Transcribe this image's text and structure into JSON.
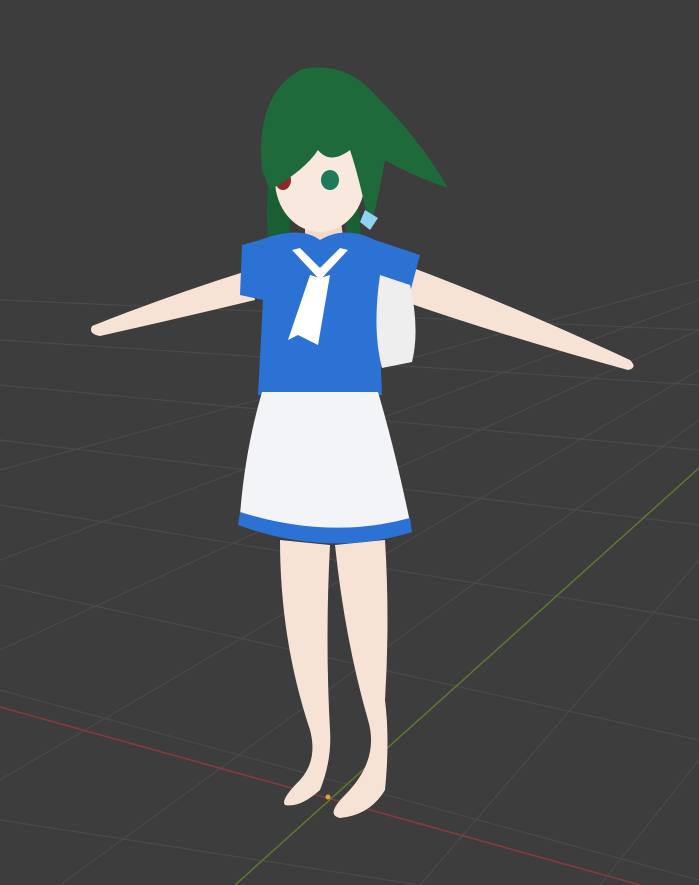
{
  "viewport": {
    "background_color": "#3d3d3d",
    "grid_color": "#4a4a4a",
    "x_axis_color": "#8a3a3f",
    "y_axis_color": "#5c7a2e"
  },
  "model": {
    "hair_color": "#1e6a3a",
    "shirt_color": "#2b72d4",
    "skirt_color": "#f2f4f8",
    "skin_color": "#f6e3d6",
    "strap_color": "#d8322e",
    "bag_color": "#f0f0f0"
  }
}
